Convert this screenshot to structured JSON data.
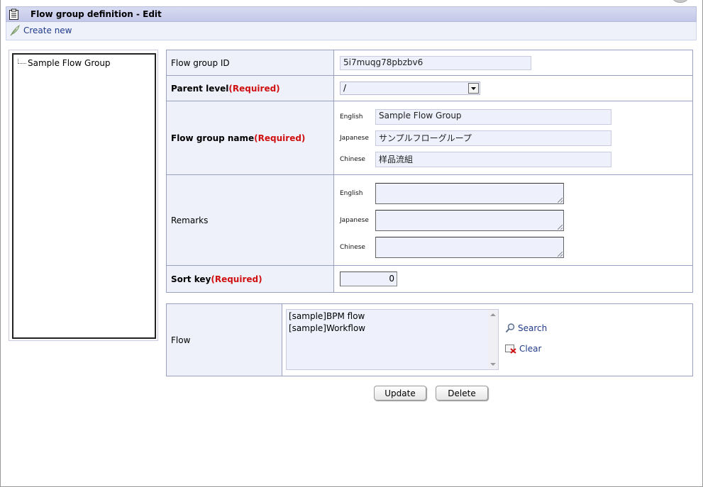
{
  "header": {
    "title": "Flow group definition - Edit",
    "title_icon": "clipboard-icon"
  },
  "toolbar": {
    "create_new_label": "Create new",
    "create_new_icon": "feather-icon"
  },
  "tree": {
    "items": [
      {
        "label": "Sample Flow Group"
      }
    ]
  },
  "form": {
    "flow_group_id": {
      "label": "Flow group ID",
      "value": "5i7muqg78pbzbv6"
    },
    "parent_level": {
      "label": "Parent level",
      "required": "(Required)",
      "value": "/"
    },
    "flow_group_name": {
      "label": "Flow group name",
      "required": "(Required)",
      "languages": [
        {
          "lang": "English",
          "value": "Sample Flow Group"
        },
        {
          "lang": "Japanese",
          "value": "サンプルフローグループ"
        },
        {
          "lang": "Chinese",
          "value": "样品流組"
        }
      ]
    },
    "remarks": {
      "label": "Remarks",
      "languages": [
        {
          "lang": "English",
          "value": ""
        },
        {
          "lang": "Japanese",
          "value": ""
        },
        {
          "lang": "Chinese",
          "value": ""
        }
      ]
    },
    "sort_key": {
      "label": "Sort key",
      "required": "(Required)",
      "value": "0"
    }
  },
  "flow": {
    "label": "Flow",
    "items": [
      "[sample]BPM flow",
      "[sample]Workflow"
    ],
    "search_label": "Search",
    "clear_label": "Clear",
    "search_icon": "magnifier-icon",
    "clear_icon": "clear-icon"
  },
  "buttons": {
    "update_label": "Update",
    "delete_label": "Delete"
  },
  "colors": {
    "required": "#d01010",
    "link": "#1f3a8a",
    "label_bg": "#eef0fa",
    "header_bg": "#c8cce9"
  }
}
